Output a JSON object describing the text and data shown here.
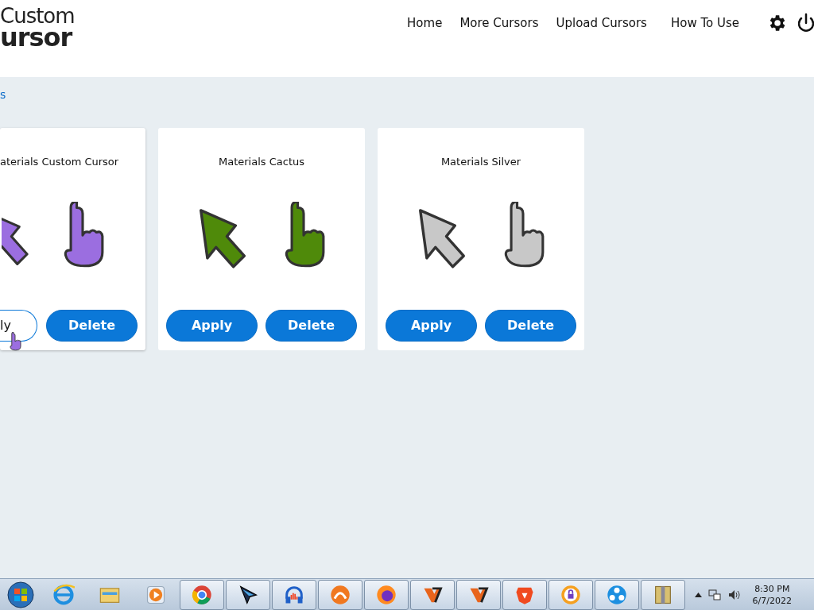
{
  "logo": {
    "line_1": "Custom",
    "line_2": "ursor"
  },
  "nav": [
    "Home",
    "More Cursors",
    "Upload Cursors",
    "How To Use"
  ],
  "breadcrumb": "s",
  "cards": [
    {
      "title": "aterials Custom Cursor",
      "color": "#9b6ee0",
      "apply": {
        "label": "ly",
        "hovered": true
      },
      "delete": "Delete",
      "cut_left": true
    },
    {
      "title": "Materials Cactus",
      "color": "#4f8a0a",
      "apply": {
        "label": "Apply",
        "hovered": false
      },
      "delete": "Delete",
      "cut_left": false
    },
    {
      "title": "Materials Silver",
      "color": "#c8c8c8",
      "apply": {
        "label": "Apply",
        "hovered": false
      },
      "delete": "Delete",
      "cut_left": false
    }
  ],
  "taskbar": {
    "apps": [
      {
        "running": false
      },
      {
        "running": false
      },
      {
        "running": false
      },
      {
        "running": true
      },
      {
        "running": true
      },
      {
        "running": true
      },
      {
        "running": true
      },
      {
        "running": true
      },
      {
        "running": true
      },
      {
        "running": true
      },
      {
        "running": true
      },
      {
        "running": true
      },
      {
        "running": true
      },
      {
        "running": true
      }
    ],
    "time": "8:30 PM",
    "date": "6/7/2022"
  }
}
